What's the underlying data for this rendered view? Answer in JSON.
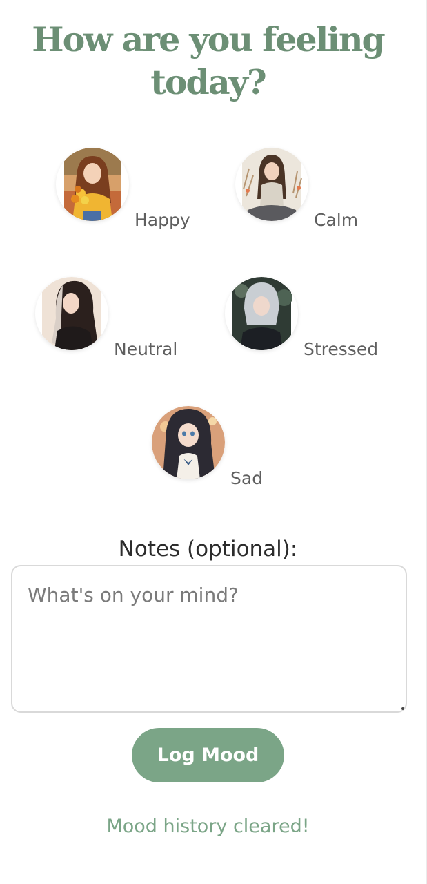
{
  "header": {
    "title": "How are you feeling today?"
  },
  "moods": [
    {
      "label": "Happy",
      "avatar_icon": "girl-with-flowers-portrait"
    },
    {
      "label": "Calm",
      "avatar_icon": "girl-sitting-in-meadow-portrait"
    },
    {
      "label": "Neutral",
      "avatar_icon": "dark-haired-woman-portrait"
    },
    {
      "label": "Stressed",
      "avatar_icon": "silver-haired-girl-portrait"
    },
    {
      "label": "Sad",
      "avatar_icon": "crying-girl-portrait"
    }
  ],
  "notes": {
    "label": "Notes (optional):",
    "placeholder": "What's on your mind?",
    "value": ""
  },
  "actions": {
    "log_label": "Log Mood"
  },
  "status": {
    "message": "Mood history cleared!"
  },
  "colors": {
    "accent": "#7ba587",
    "title": "#6c8f75",
    "label": "#5f5f5f"
  }
}
